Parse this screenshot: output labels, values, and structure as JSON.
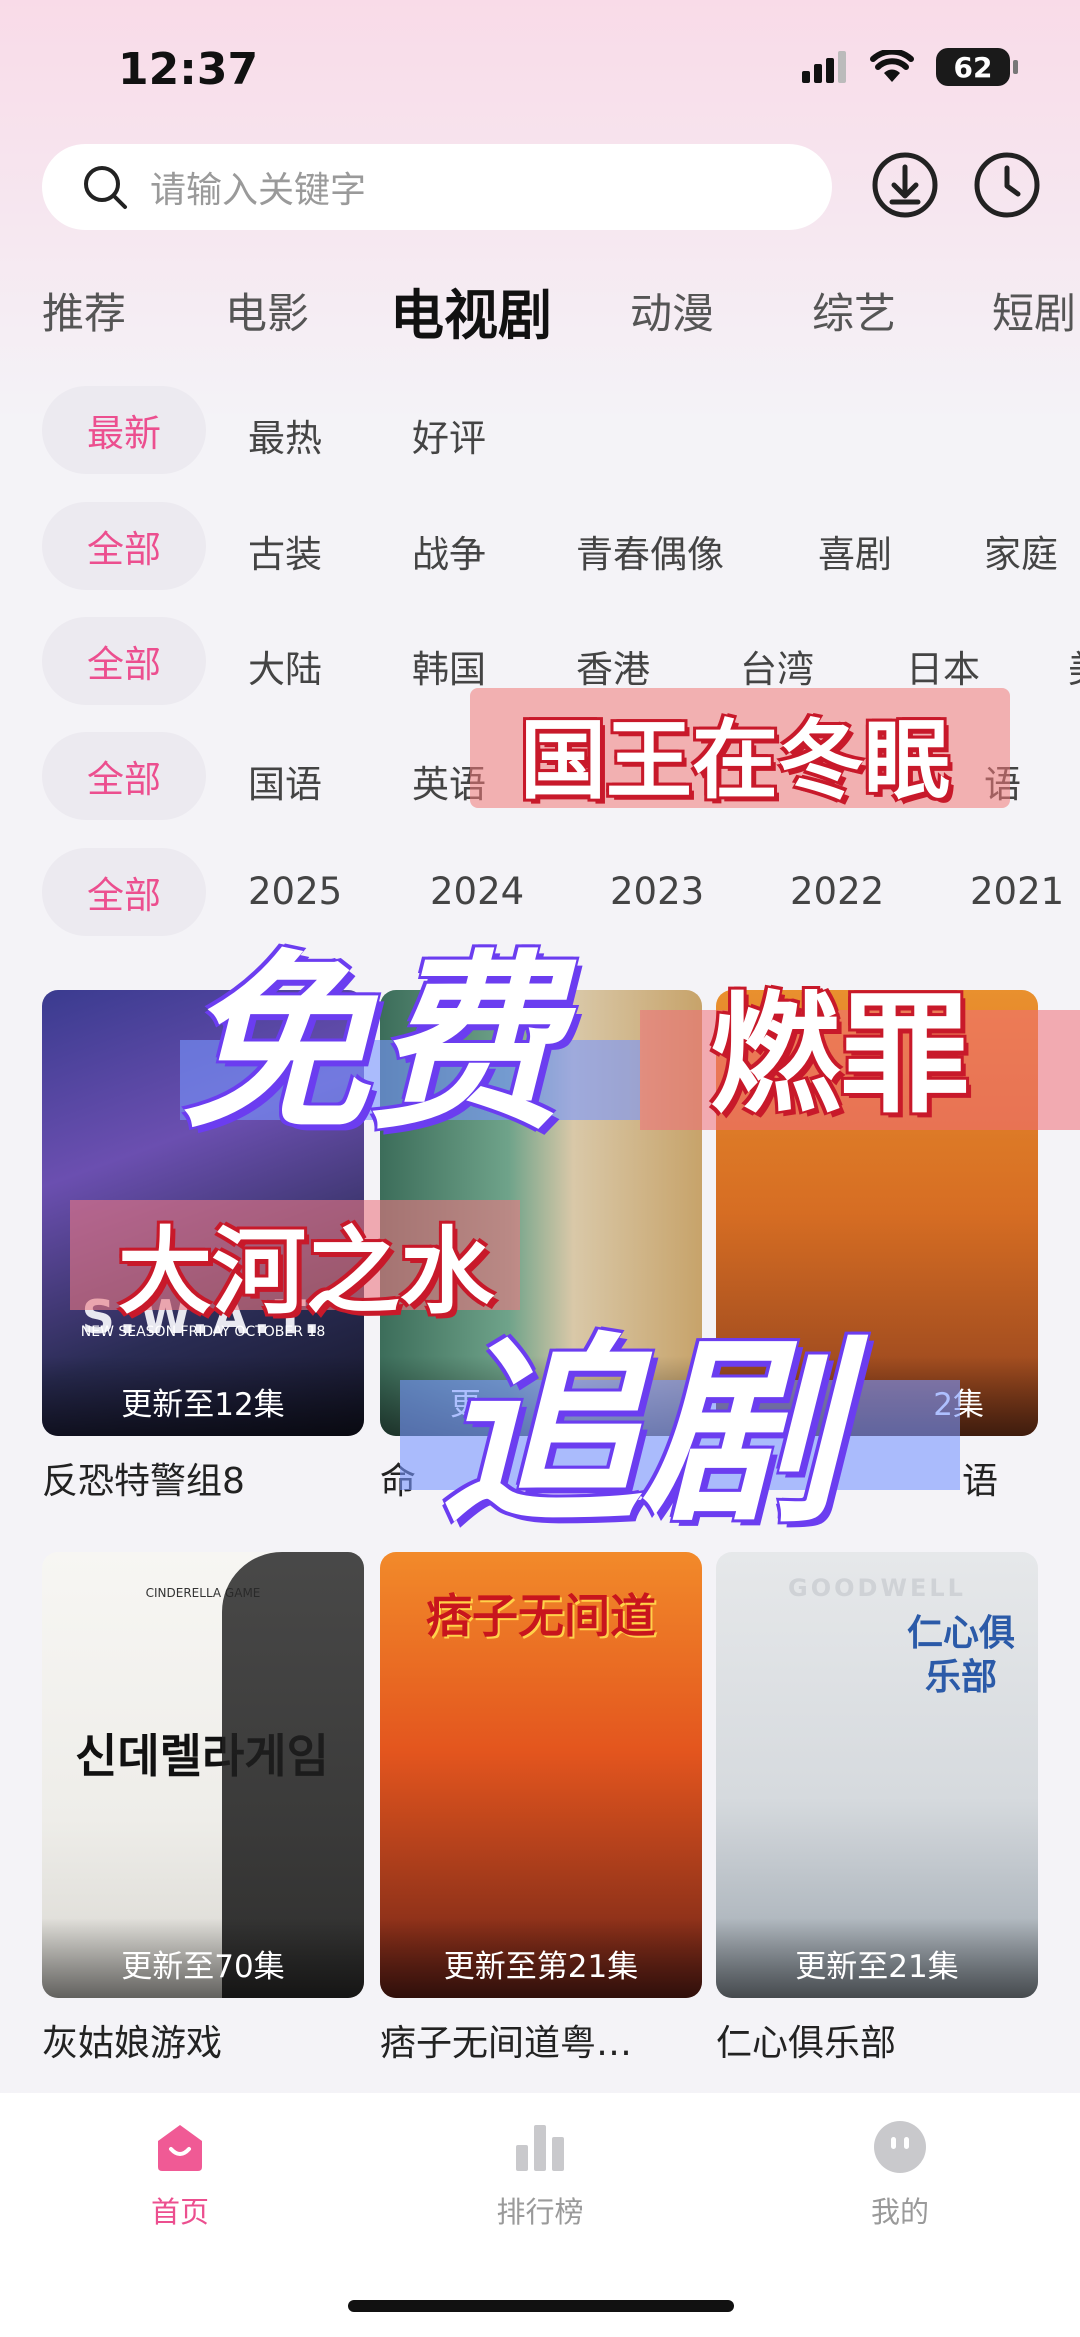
{
  "status_bar": {
    "time": "12:37",
    "battery": "62"
  },
  "search": {
    "placeholder": "请输入关键字"
  },
  "top_tabs": [
    "推荐",
    "电影",
    "电视剧",
    "动漫",
    "综艺",
    "短剧"
  ],
  "filters": {
    "sort": {
      "chip": "最新",
      "options": [
        "最热",
        "好评"
      ]
    },
    "genre": {
      "chip": "全部",
      "options": [
        "古装",
        "战争",
        "青春偶像",
        "喜剧",
        "家庭"
      ]
    },
    "region": {
      "chip": "全部",
      "options": [
        "大陆",
        "韩国",
        "香港",
        "台湾",
        "日本",
        "美"
      ]
    },
    "language": {
      "chip": "全部",
      "options": [
        "国语",
        "英语",
        "语"
      ]
    },
    "year": {
      "chip": "全部",
      "options": [
        "2025",
        "2024",
        "2023",
        "2022",
        "2021"
      ]
    }
  },
  "cards": [
    {
      "title": "反恐特警组8",
      "badge": "更新至12集",
      "poster_text": "S.W.A.T.",
      "poster_sub": "NEW SEASON FRIDAY OCTOBER 18"
    },
    {
      "title": "命",
      "badge": "更"
    },
    {
      "title": "语",
      "badge": "2集"
    },
    {
      "title": "灰姑娘游戏",
      "badge": "更新至70集",
      "poster_text": "신데렐라게임",
      "poster_sub": "CINDERELLA GAME"
    },
    {
      "title": "痞子无间道粤…",
      "badge": "更新至第21集",
      "poster_text": "痞子无间道"
    },
    {
      "title": "仁心俱乐部",
      "badge": "更新至21集",
      "poster_text": "仁心俱乐部",
      "poster_sub": "GOODWELL"
    }
  ],
  "overlay_text": {
    "line1": "国王在冬眠",
    "line2": "免费",
    "line3": "燃罪",
    "line4": "大河之水",
    "line5": "追剧"
  },
  "bottom_nav": [
    {
      "label": "首页",
      "active": true
    },
    {
      "label": "排行榜",
      "active": false
    },
    {
      "label": "我的",
      "active": false
    }
  ],
  "colors": {
    "accent": "#ec4f8f",
    "overlay_purple": "#6b3df0",
    "overlay_red": "#c8192a"
  }
}
